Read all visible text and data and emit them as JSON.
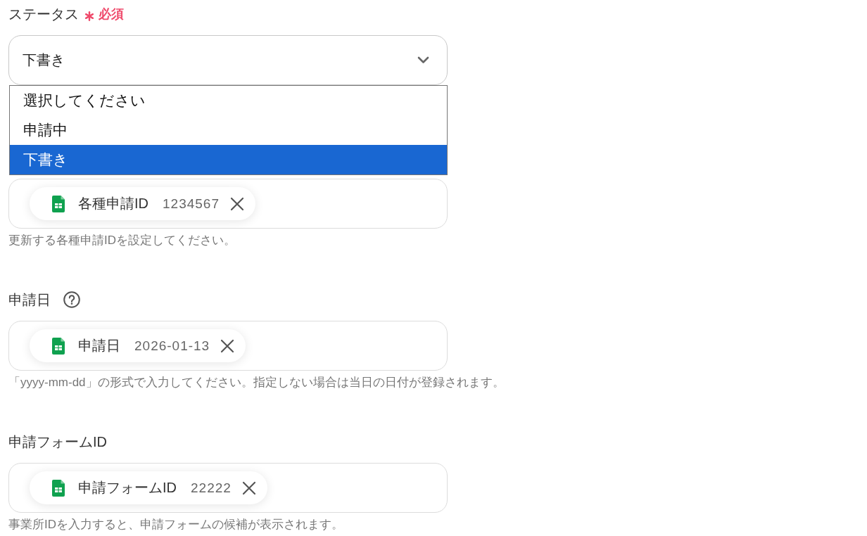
{
  "fields": [
    {
      "kind": "select",
      "label": "ステータス",
      "required": true,
      "required_text": "必須",
      "help": false,
      "value": "下書き",
      "menu_open": true,
      "options": [
        {
          "label": "選択してください",
          "selected": false
        },
        {
          "label": "申請中",
          "selected": false
        },
        {
          "label": "下書き",
          "selected": true
        }
      ]
    },
    {
      "kind": "tokens",
      "tokens": [
        {
          "name": "各種申請ID",
          "value": "1234567"
        }
      ],
      "hint": "更新する各種申請IDを設定してください。"
    },
    {
      "kind": "tokens",
      "label": "申請日",
      "required": false,
      "help": true,
      "tokens": [
        {
          "name": "申請日",
          "value": "2026-01-13"
        }
      ],
      "hint": "「yyyy-mm-dd」の形式で入力してください。指定しない場合は当日の日付が登録されます。"
    },
    {
      "kind": "tokens",
      "label": "申請フォームID",
      "required": false,
      "help": false,
      "tokens": [
        {
          "name": "申請フォームID",
          "value": "22222"
        }
      ],
      "hint": "事業所IDを入力すると、申請フォームの候補が表示されます。"
    }
  ]
}
